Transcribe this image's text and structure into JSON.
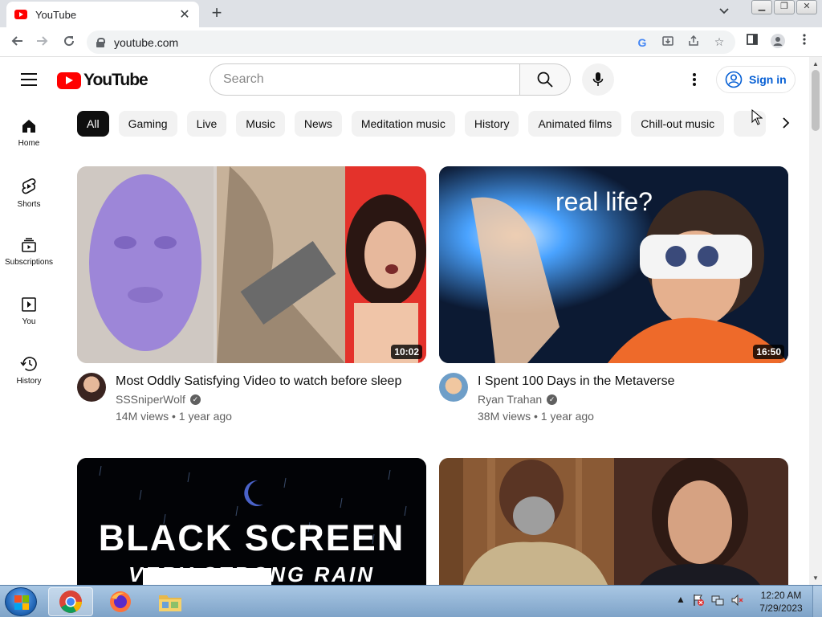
{
  "browser": {
    "tab_title": "YouTube",
    "url": "youtube.com"
  },
  "masthead": {
    "logo_text": "YouTube",
    "search_placeholder": "Search",
    "signin_label": "Sign in"
  },
  "chips": [
    "All",
    "Gaming",
    "Live",
    "Music",
    "News",
    "Meditation music",
    "History",
    "Animated films",
    "Chill-out music"
  ],
  "sidebar": [
    {
      "label": "Home",
      "icon": "home-icon"
    },
    {
      "label": "Shorts",
      "icon": "shorts-icon"
    },
    {
      "label": "Subscriptions",
      "icon": "subscriptions-icon"
    },
    {
      "label": "You",
      "icon": "you-icon"
    },
    {
      "label": "History",
      "icon": "history-icon"
    }
  ],
  "videos": [
    {
      "title": "Most Oddly Satisfying Video to watch before sleep",
      "channel": "SSSniperWolf",
      "stats": "14M views • 1 year ago",
      "duration": "10:02"
    },
    {
      "title": "I Spent 100 Days in the Metaverse",
      "channel": "Ryan Trahan",
      "stats": "38M views • 1 year ago",
      "duration": "16:50",
      "thumb_text": "real life?"
    },
    {
      "thumb_text": "BLACK SCREEN",
      "thumb_subtext": "VERY STRONG RAIN"
    },
    {}
  ],
  "taskbar": {
    "time": "12:20 AM",
    "date": "7/29/2023"
  },
  "colors": {
    "youtube_red": "#ff0000",
    "link_blue": "#065fd4"
  }
}
